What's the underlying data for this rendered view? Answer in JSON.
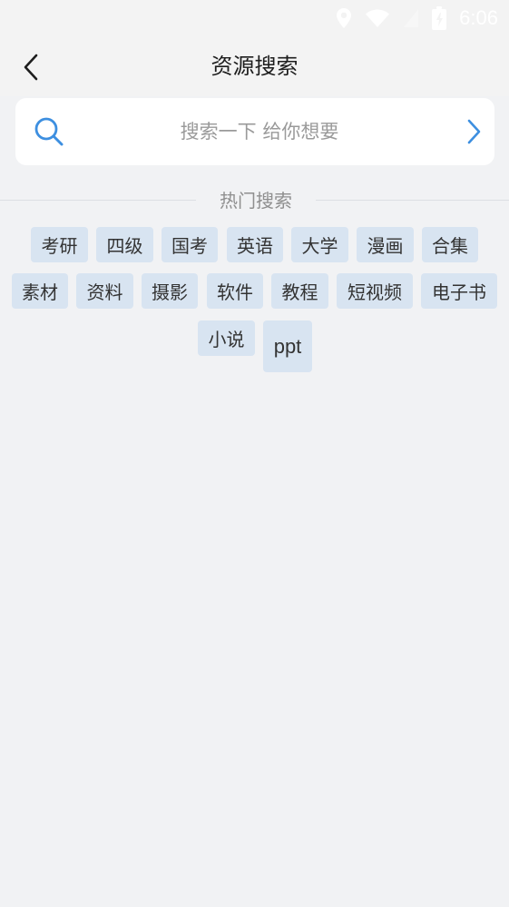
{
  "status_bar": {
    "time": "6:06",
    "icons": [
      "location-icon",
      "wifi-icon",
      "signal-icon",
      "battery-icon"
    ]
  },
  "header": {
    "back_icon": "chevron-left-icon",
    "title": "资源搜索"
  },
  "search": {
    "icon": "search-icon",
    "placeholder": "搜索一下 给你想要",
    "value": "",
    "go_icon": "chevron-right-icon",
    "accent_color": "#3d8fe0"
  },
  "hot_search": {
    "title": "热门搜索",
    "tags": [
      {
        "label": "考研"
      },
      {
        "label": "四级"
      },
      {
        "label": "国考"
      },
      {
        "label": "英语"
      },
      {
        "label": "大学"
      },
      {
        "label": "漫画"
      },
      {
        "label": "合集"
      },
      {
        "label": "素材"
      },
      {
        "label": "资料"
      },
      {
        "label": "摄影"
      },
      {
        "label": "软件"
      },
      {
        "label": "教程"
      },
      {
        "label": "短视频"
      },
      {
        "label": "电子书"
      },
      {
        "label": "小说"
      },
      {
        "label": "ppt"
      }
    ]
  },
  "colors": {
    "background": "#f1f2f4",
    "tag_background": "#d8e4f1",
    "tag_text": "#333333",
    "muted_text": "#8f8f8f"
  }
}
